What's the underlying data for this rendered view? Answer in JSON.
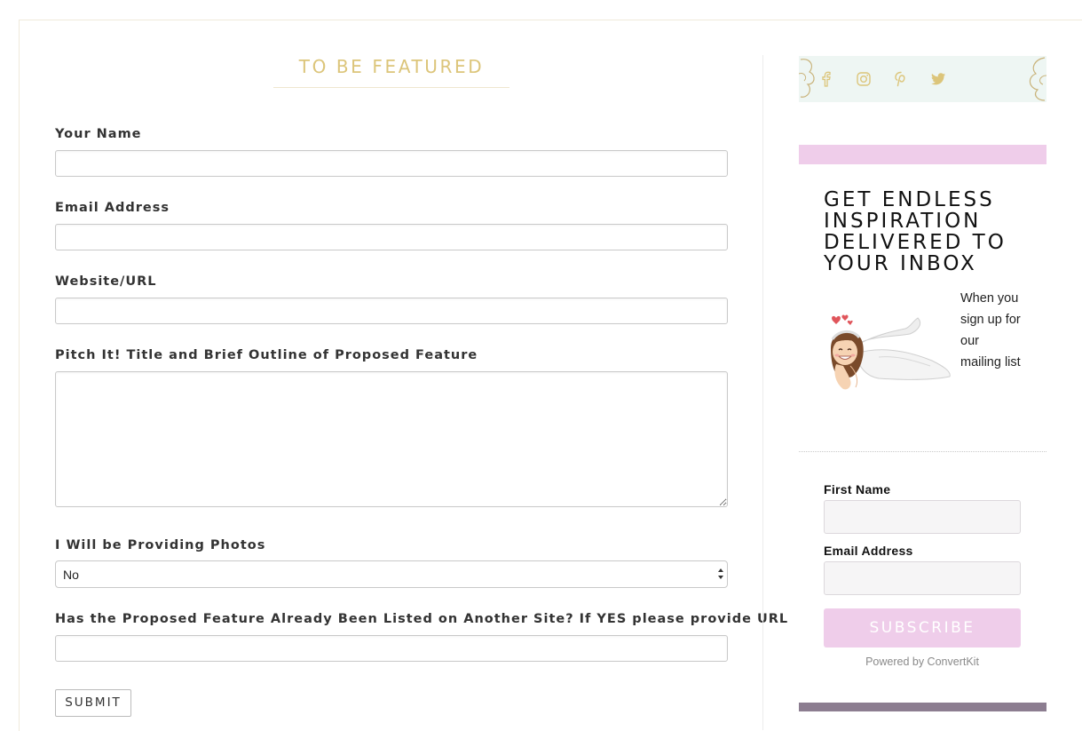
{
  "form": {
    "title": "TO BE FEATURED",
    "name_label": "Your Name",
    "email_label": "Email Address",
    "website_label": "Website/URL",
    "pitch_label": "Pitch It! Title and Brief Outline of Proposed Feature",
    "photos_label": "I Will be Providing Photos",
    "photos_value": "No",
    "listed_label": "Has the Proposed Feature Already Been Listed on Another Site? If YES please provide URL",
    "submit_label": "SUBMIT"
  },
  "sidebar": {
    "social_icons": [
      "facebook-icon",
      "instagram-icon",
      "pinterest-icon",
      "twitter-icon"
    ],
    "social_color": "#dcc57a",
    "newsletter": {
      "title": "GET ENDLESS INSPIRATION DELIVERED TO YOUR INBOX",
      "description": "When you sign up for our mailing list",
      "first_name_label": "First Name",
      "email_label": "Email Address",
      "subscribe_label": "SUBSCRIBE",
      "powered_by": "Powered by ConvertKit"
    }
  },
  "colors": {
    "gold": "#dcc57a",
    "pink": "#efcdea",
    "mint": "#eef6f3",
    "mauve": "#8c7d90"
  }
}
